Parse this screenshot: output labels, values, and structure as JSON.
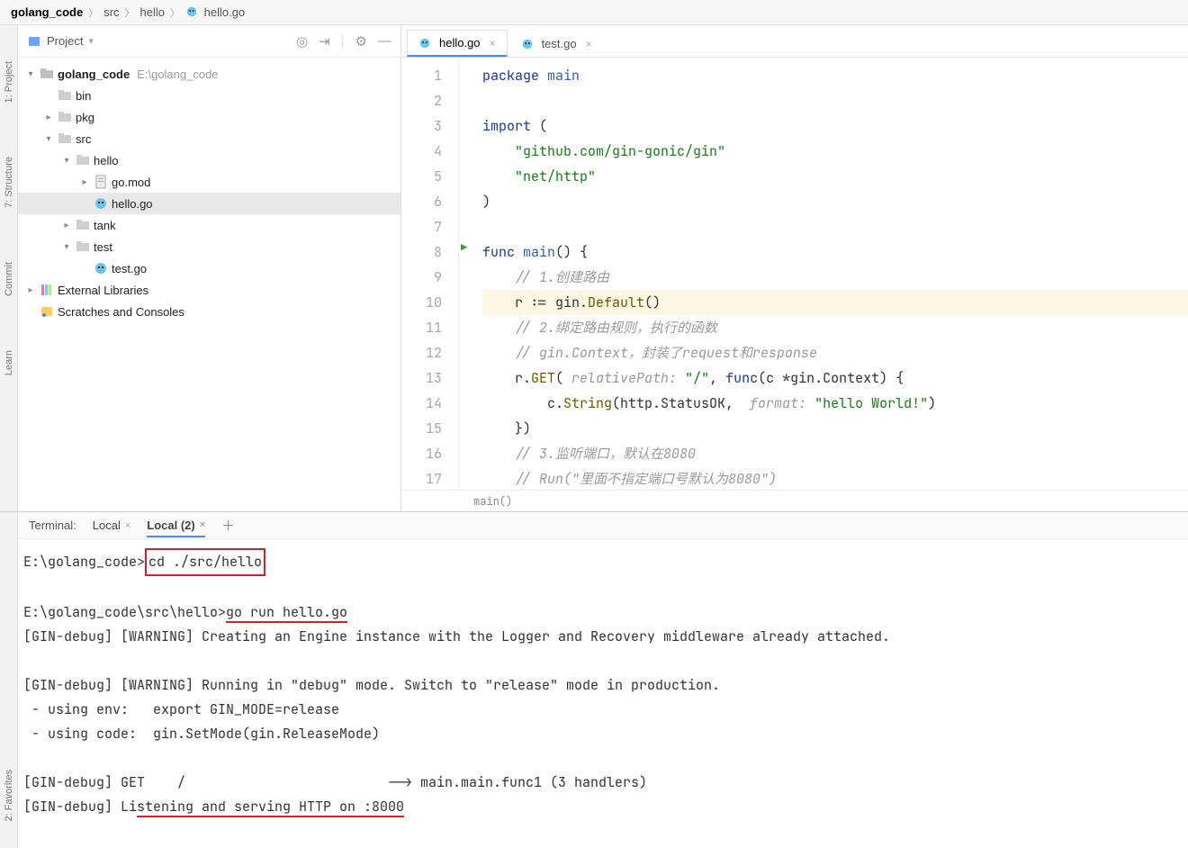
{
  "breadcrumb": {
    "seg1": "golang_code",
    "seg2": "src",
    "seg3": "hello",
    "seg4": "hello.go"
  },
  "leftSpine": {
    "a": "1: Project",
    "b": "7: Structure",
    "c": "Commit",
    "d": "Learn"
  },
  "sidebar": {
    "title": "Project",
    "icons": {
      "target": "target",
      "col": "collapse",
      "gear": "gear",
      "more": "more"
    },
    "tree": {
      "root": "golang_code",
      "rootHint": "E:\\golang_code",
      "bin": "bin",
      "pkg": "pkg",
      "src": "src",
      "hello": "hello",
      "gomod": "go.mod",
      "hellogo": "hello.go",
      "tank": "tank",
      "test": "test",
      "testgo": "test.go",
      "ext": "External Libraries",
      "scr": "Scratches and Consoles"
    }
  },
  "tabs": {
    "t1": "hello.go",
    "t2": "test.go"
  },
  "code": {
    "l1a": "package ",
    "l1b": "main",
    "l3a": "import ",
    "l3b": "(",
    "l4": "    \"github.com/gin-gonic/gin\"",
    "l5": "    \"net/http\"",
    "l6": ")",
    "l8a": "func ",
    "l8b": "main",
    "l8c": "() {",
    "l9": "    // 1.创建路由",
    "l10a": "    r := gin.",
    "l10b": "Default",
    "l10c": "()",
    "l11": "    // 2.绑定路由规则，执行的函数",
    "l12": "    // gin.Context，封装了request和response",
    "l13a": "    r.",
    "l13b": "GET",
    "l13c": "( ",
    "l13p": "relativePath:",
    "l13d": " \"/\"",
    "l13e": ", ",
    "l13f": "func",
    "l13g": "(c *gin.Context) {",
    "l14a": "        c.",
    "l14b": "String",
    "l14c": "(http.StatusOK,  ",
    "l14p": "format:",
    "l14d": " \"hello World!\"",
    "l14e": ")",
    "l15": "    })",
    "l16": "    // 3.监听端口，默认在8080",
    "l17": "    // Run(\"里面不指定端口号默认为8080\")"
  },
  "editorStatus": "main()",
  "terminal": {
    "label": "Terminal:",
    "tab1": "Local",
    "tab2": "Local (2)",
    "out": {
      "p1a": "E:\\golang_code>",
      "p1b": "cd ./src/hello",
      "p2a": "E:\\golang_code\\src\\hello>",
      "p2b": "go run hello.go",
      "p3": "[GIN-debug] [WARNING] Creating an Engine instance with the Logger and Recovery middleware already attached.",
      "p4": "[GIN-debug] [WARNING] Running in \"debug\" mode. Switch to \"release\" mode in production.",
      "p5": " - using env:   export GIN_MODE=release",
      "p6": " - using code:  gin.SetMode(gin.ReleaseMode)",
      "p7": "[GIN-debug] GET    /                         --> main.main.func1 (3 handlers)",
      "p8a": "[GIN-debug] Li",
      "p8b": "stening and serving HTTP on :8000"
    }
  },
  "rightSpine": {
    "fav": "2: Favorites"
  }
}
